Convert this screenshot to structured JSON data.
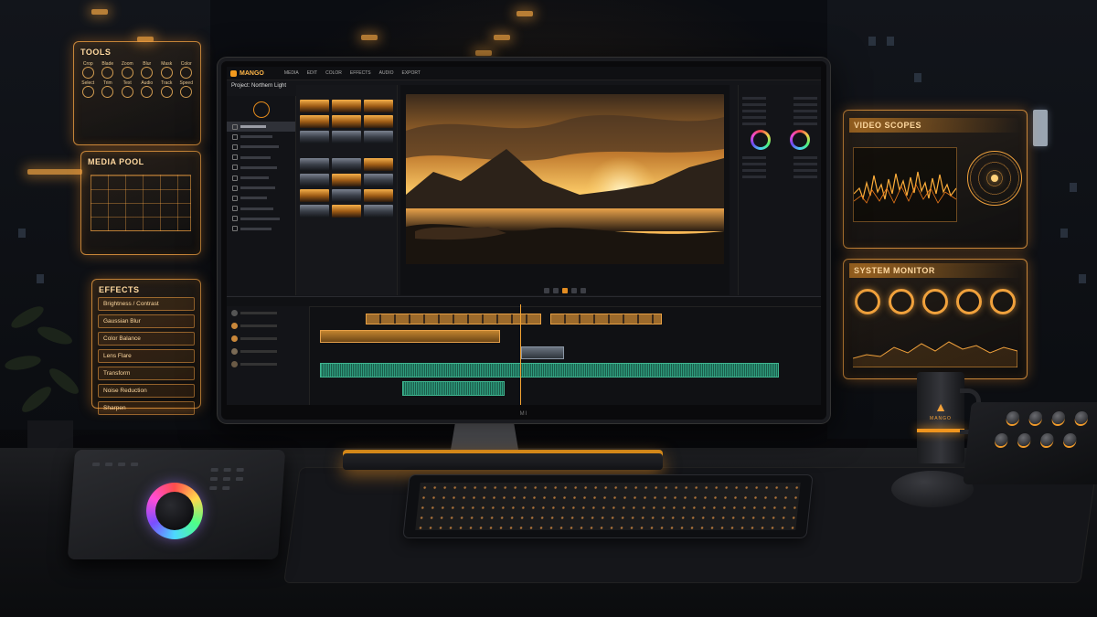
{
  "app": {
    "name": "MANGO",
    "project": "Project: Northern Light",
    "monitor_brand": "MI",
    "menu": [
      "MEDIA",
      "EDIT",
      "COLOR",
      "EFFECTS",
      "AUDIO",
      "EXPORT"
    ]
  },
  "holo_panels": {
    "tools": {
      "title": "TOOLS",
      "items": [
        "Crop",
        "Blade",
        "Zoom",
        "Blur",
        "Mask",
        "Color",
        "Select",
        "Trim",
        "Text",
        "Audio",
        "Track",
        "Speed"
      ]
    },
    "media_pool": {
      "title": "MEDIA POOL"
    },
    "effects": {
      "title": "EFFECTS",
      "items": [
        "Brightness / Contrast",
        "Gaussian Blur",
        "Color Balance",
        "Lens Flare",
        "Transform",
        "Noise Reduction",
        "Sharpen"
      ]
    },
    "video_scopes": {
      "title": "VIDEO SCOPES"
    },
    "system_monitor": {
      "title": "SYSTEM MONITOR",
      "gauges": [
        "CPU",
        "GPU",
        "RAM",
        "DISK",
        "NET"
      ]
    }
  },
  "mug": {
    "brand": "MANGO"
  },
  "colors": {
    "accent": "#f39a1e",
    "accent_glow": "#ffb648",
    "panel_bg": "#141519",
    "audio_clip": "#2e9c7d"
  },
  "icons": {
    "timeline_toggles": [
      "eye-icon",
      "lock-icon",
      "mute-icon"
    ],
    "transport": [
      "skip-back-icon",
      "step-back-icon",
      "play-icon",
      "step-forward-icon",
      "skip-forward-icon"
    ]
  },
  "playhead_position": 0.41
}
